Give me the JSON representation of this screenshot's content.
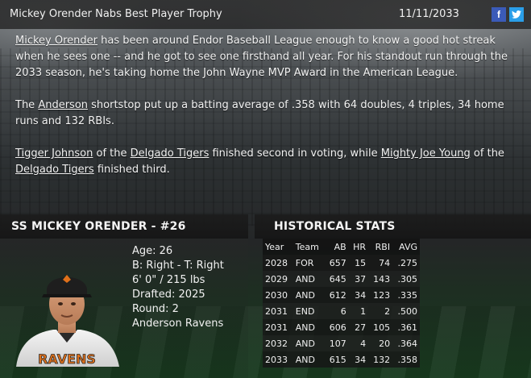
{
  "header": {
    "title": "Mickey Orender Nabs Best Player Trophy",
    "date": "11/11/2033",
    "facebook_label": "f",
    "twitter_label": "t"
  },
  "story": {
    "p1_link_player": "Mickey Orender",
    "p1_text": " has been around Endor Baseball League enough to know a good hot streak when he sees one -- and he got to see one firsthand all year. For his standout run through the 2033 season, he's taking home the John Wayne MVP Award in the American League.",
    "p2_pre": "The ",
    "p2_link_team": "Anderson",
    "p2_text": " shortstop put up a batting average of .358 with 64 doubles, 4 triples, 34 home runs and 132 RBIs.",
    "p3_link_player2": "Tigger Johnson",
    "p3_text_a": " of the ",
    "p3_link_team2": "Delgado Tigers",
    "p3_text_b": " finished second in voting, while ",
    "p3_link_player3": "Mighty Joe Young",
    "p3_text_c": " of the ",
    "p3_link_team3": "Delgado Tigers",
    "p3_text_d": " finished third."
  },
  "player": {
    "heading": "SS MICKEY ORENDER - #26",
    "age": "Age: 26",
    "bats_throws": "B: Right - T: Right",
    "height_weight": "6' 0\" / 215 lbs",
    "drafted": "Drafted: 2025",
    "round": "Round: 2",
    "team": "Anderson Ravens",
    "jersey_text": "RAVENS"
  },
  "stats": {
    "heading": "HISTORICAL STATS",
    "columns": [
      "Year",
      "Team",
      "AB",
      "HR",
      "RBI",
      "AVG"
    ],
    "rows": [
      [
        "2028",
        "FOR",
        "657",
        "15",
        "74",
        ".275"
      ],
      [
        "2029",
        "AND",
        "645",
        "37",
        "143",
        ".305"
      ],
      [
        "2030",
        "AND",
        "612",
        "34",
        "123",
        ".335"
      ],
      [
        "2031",
        "END",
        "6",
        "1",
        "2",
        ".500"
      ],
      [
        "2031",
        "AND",
        "606",
        "27",
        "105",
        ".361"
      ],
      [
        "2032",
        "AND",
        "107",
        "4",
        "20",
        ".364"
      ],
      [
        "2033",
        "AND",
        "615",
        "34",
        "132",
        ".358"
      ]
    ]
  },
  "colors": {
    "facebook": "#3b5bb8",
    "twitter": "#2a9ee8",
    "jersey_orange": "#e0701a"
  }
}
